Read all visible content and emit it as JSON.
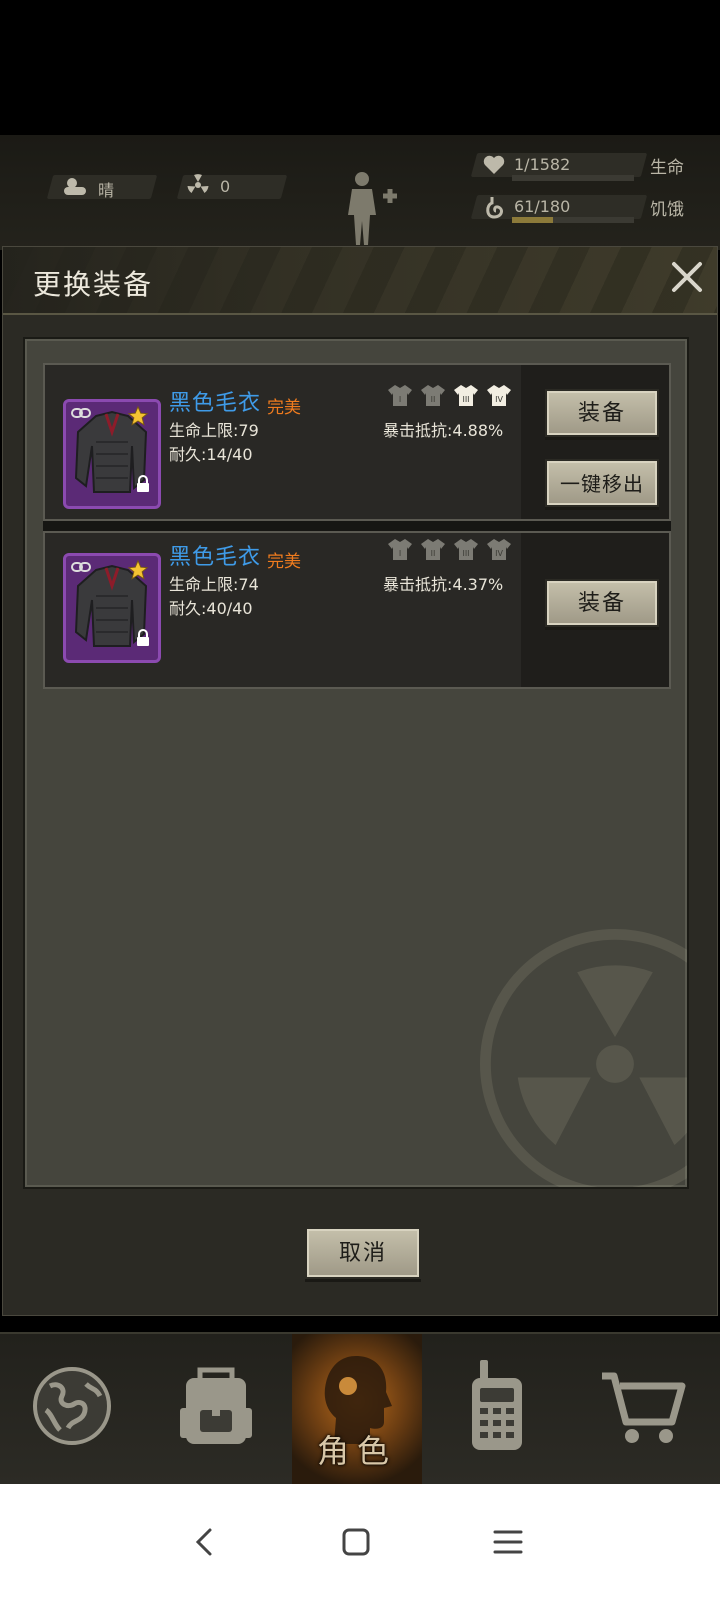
{
  "hud": {
    "weather": "晴",
    "radiation": "0",
    "health_value": "1/1582",
    "health_label": "生命",
    "health_fill": 0.001,
    "hunger_value": "61/180",
    "hunger_label": "饥饿",
    "hunger_fill": 0.34
  },
  "dialog": {
    "title": "更换装备",
    "cancel_label": "取消"
  },
  "items": [
    {
      "name": "黑色毛衣",
      "quality": "完美",
      "stat_hp": "生命上限:79",
      "stat_durability": "耐久:14/40",
      "extra": "暴击抵抗:4.88%",
      "tiers_unlocked": [
        false,
        false,
        true,
        true
      ],
      "equip_label": "装备",
      "remove_label": "一键移出"
    },
    {
      "name": "黑色毛衣",
      "quality": "完美",
      "stat_hp": "生命上限:74",
      "stat_durability": "耐久:40/40",
      "extra": "暴击抵抗:4.37%",
      "tiers_unlocked": [
        false,
        false,
        false,
        false
      ],
      "equip_label": "装备"
    }
  ],
  "nav": {
    "active_label": "角色"
  },
  "colors": {
    "accent_blue": "#3f9be8",
    "quality_orange": "#ef7b1e",
    "item_frame": "#8b4ab0",
    "active_nav": "#b86a1b"
  }
}
